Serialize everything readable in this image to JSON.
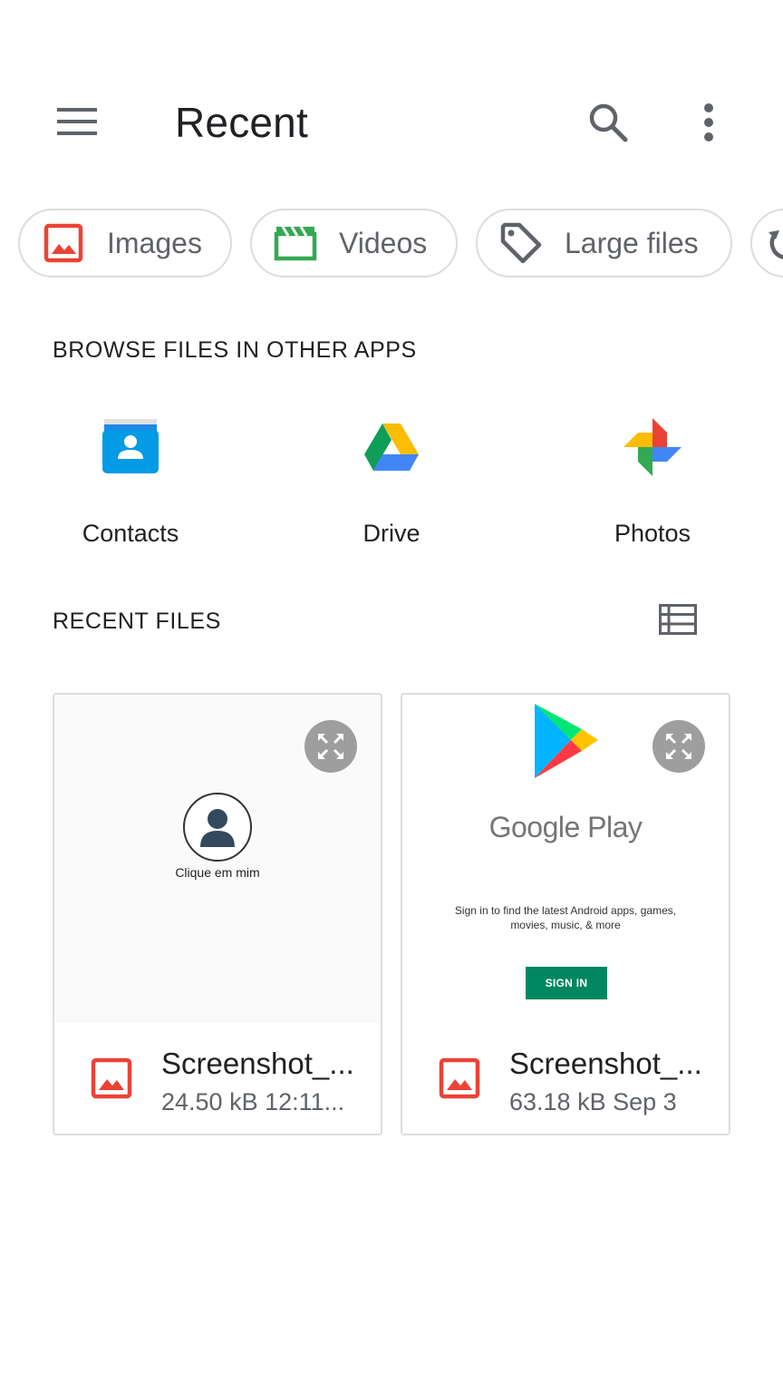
{
  "header": {
    "title": "Recent",
    "menu_icon": "hamburger-menu-icon",
    "search_icon": "search-icon",
    "more_icon": "more-vert-icon"
  },
  "chips": [
    {
      "label": "Images",
      "icon": "image-icon",
      "color": "#ea4335"
    },
    {
      "label": "Videos",
      "icon": "movie-clapper-icon",
      "color": "#34a853"
    },
    {
      "label": "Large files",
      "icon": "tag-icon",
      "color": "#5f6368"
    }
  ],
  "browse": {
    "title": "BROWSE FILES IN OTHER APPS",
    "apps": [
      {
        "label": "Contacts",
        "icon": "contacts-app-icon"
      },
      {
        "label": "Drive",
        "icon": "drive-app-icon"
      },
      {
        "label": "Photos",
        "icon": "photos-app-icon"
      }
    ]
  },
  "recent": {
    "title": "RECENT FILES",
    "view_icon": "list-view-icon",
    "files": [
      {
        "name": "Screenshot_...",
        "info": "24.50 kB 12:11...",
        "thumb_caption": "Clique em mim"
      },
      {
        "name": "Screenshot_...",
        "info": "63.18 kB Sep 3",
        "thumb_brand": "Google Play",
        "thumb_text": "Sign in to find the latest Android apps, games, movies, music, & more",
        "thumb_button": "SIGN IN"
      }
    ]
  },
  "colors": {
    "text_primary": "#202124",
    "text_secondary": "#5f6368",
    "border": "#dadce0",
    "image_red": "#ea4335",
    "video_green": "#34a853",
    "play_green": "#01875f"
  }
}
